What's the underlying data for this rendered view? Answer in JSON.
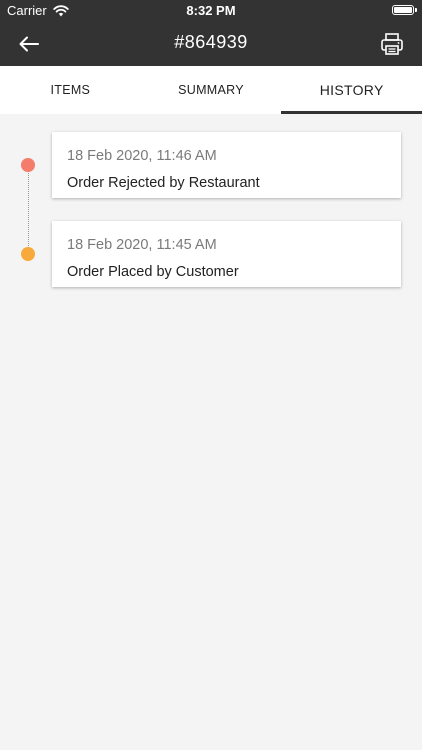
{
  "status_bar": {
    "carrier": "Carrier",
    "time": "8:32 PM"
  },
  "header": {
    "title": "#864939",
    "back_icon": "arrow-left-icon",
    "print_icon": "printer-icon"
  },
  "tabs": [
    {
      "label": "ITEMS",
      "active": false
    },
    {
      "label": "SUMMARY",
      "active": false
    },
    {
      "label": "HISTORY",
      "active": true
    }
  ],
  "history": [
    {
      "time": "18 Feb 2020, 11:46 AM",
      "event": "Order Rejected by Restaurant",
      "dot_color": "#f47c6b"
    },
    {
      "time": "18 Feb 2020, 11:45 AM",
      "event": "Order Placed by Customer",
      "dot_color": "#f7a93b"
    }
  ],
  "colors": {
    "header_bg": "#333333",
    "page_bg": "#f4f4f4"
  }
}
